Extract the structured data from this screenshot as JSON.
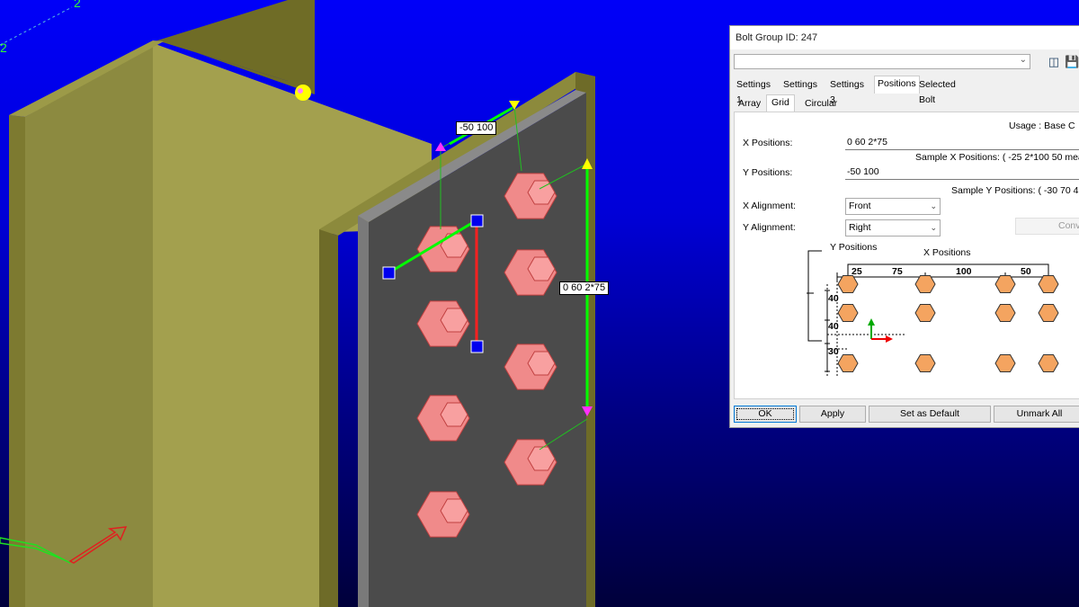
{
  "viewport": {
    "axis_labels": [
      "2",
      "2"
    ],
    "tags": {
      "y_positions": "-50 100",
      "x_positions": "0 60 2*75"
    }
  },
  "dialog": {
    "title": "Bolt Group ID: 247",
    "tabs": [
      "Settings 1",
      "Settings 2",
      "Settings 3",
      "Positions",
      "Selected Bolt Data"
    ],
    "active_tab": "Positions",
    "subtabs": [
      "Array",
      "Grid",
      "Circular"
    ],
    "active_subtab": "Grid",
    "usage": "Usage : Base C",
    "x_positions": {
      "label": "X Positions:",
      "value": "0 60 2*75"
    },
    "x_sample": "Sample X Positions: ( -25  2*100 50 means -",
    "y_positions": {
      "label": "Y Positions:",
      "value": "-50 100"
    },
    "y_sample": "Sample Y Positions: ( -30 70 40 mea",
    "x_alignment": {
      "label": "X Alignment:",
      "value": "Front"
    },
    "y_alignment": {
      "label": "Y Alignment:",
      "value": "Right"
    },
    "convert_button": "Conv",
    "diagram": {
      "y_title": "Y Positions",
      "x_title": "X Positions",
      "x_dims": [
        "25",
        "75",
        "100",
        "50"
      ],
      "y_dims": [
        "40",
        "40",
        "30"
      ]
    },
    "buttons": {
      "ok": "OK",
      "apply": "Apply",
      "set_default": "Set as Default",
      "unmark_all": "Unmark All"
    },
    "colors": {
      "bolt": "#f4a460",
      "bolt_3d": "#f08a8a",
      "steel": "#8f8b3a",
      "plate": "#4b4b4b",
      "handle": "#0000ee"
    }
  }
}
